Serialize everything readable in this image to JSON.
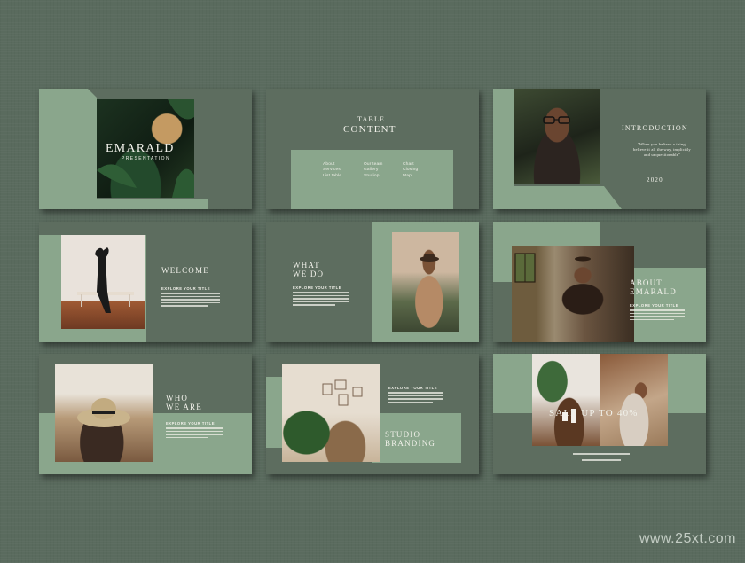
{
  "colors": {
    "background": "#5a6b5e",
    "slide_dark": "#5d6d5f",
    "slide_light": "#8aa68c",
    "text": "#f1f1ea"
  },
  "slides": {
    "s1": {
      "title": "EMARALD",
      "subtitle": "PRESENTATION"
    },
    "s2": {
      "title_line1": "TABLE",
      "title_line2": "CONTENT",
      "toc_col1": [
        "About",
        "Services",
        "List table"
      ],
      "toc_col2": [
        "Our team",
        "Gallery",
        "Studiop"
      ],
      "toc_col3": [
        "Chart",
        "Closing",
        "Map"
      ]
    },
    "s3": {
      "title": "INTRODUCTION",
      "quote_line1": "\"When you believe a thing,",
      "quote_line2": "believe it all the way, implicitly",
      "quote_line3": "and unquestionable\"",
      "year": "2020"
    },
    "s4": {
      "title": "WELCOME",
      "caption": "EXPLORE YOUR TITLE"
    },
    "s5": {
      "title_line1": "WHAT",
      "title_line2": "WE DO",
      "caption": "EXPLORE YOUR TITLE"
    },
    "s6": {
      "title_line1": "ABOUT",
      "title_line2": "EMARALD",
      "caption": "EXPLORE YOUR TITLE"
    },
    "s7": {
      "title_line1": "WHO",
      "title_line2": "WE ARE",
      "caption": "EXPLORE YOUR TITLE"
    },
    "s8": {
      "caption": "EXPLORE YOUR TITLE",
      "title_line1": "STUDIO",
      "title_line2": "BRANDING"
    },
    "s9": {
      "title": "SALE UP TO 40%"
    }
  },
  "watermark": "www.25xt.com"
}
